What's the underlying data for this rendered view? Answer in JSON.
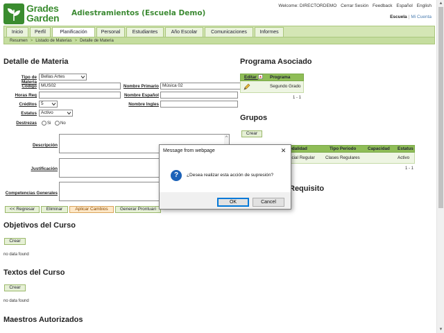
{
  "logo": {
    "line1": "Grades",
    "line2": "Garden"
  },
  "app_title": "Adiestramientos (Escuela Demo)",
  "toplinks": {
    "welcome": "Welcome: DIRECTORDEMO",
    "logout": "Cerrar Sesión",
    "feedback": "Feedback",
    "spanish": "Español",
    "english": "English"
  },
  "account": {
    "school": "Escuela",
    "my_account": "Mi Cuenta"
  },
  "nav": {
    "tabs": [
      "Inicio",
      "Perfil",
      "Planificación",
      "Personal",
      "Estudiantes",
      "Año Escolar",
      "Comunicaciones",
      "Informes"
    ],
    "active": "Planificación"
  },
  "breadcrumb": [
    "Resumen",
    "Listado de Materias",
    "Detalle de Materia"
  ],
  "detail": {
    "heading": "Detalle de Materia",
    "labels": {
      "tipo": "Tipo de Materia",
      "codigo": "Código",
      "horas": "Horas Req",
      "creditos": "Créditos",
      "estatus": "Estatus",
      "destrezas": "Destrezas",
      "nombre_primario": "Nombre Primario",
      "nombre_espanol": "Nombre Español",
      "nombre_ingles": "Nombre Ingles",
      "descripcion": "Descripción",
      "justificacion": "Justificación",
      "competencias": "Competencias Generales"
    },
    "values": {
      "tipo": "Bellas Artes",
      "codigo": "MUS02",
      "horas": "",
      "creditos": "5",
      "estatus": "Activo",
      "nombre_primario": "Música 02",
      "nombre_espanol": "",
      "nombre_ingles": ""
    },
    "radio": {
      "si": "Si",
      "no": "No"
    },
    "buttons": {
      "back": "<< Regresar",
      "delete": "Eliminar",
      "apply": "Aplicar Cambios",
      "generate": "Generar Prontuari"
    }
  },
  "objetivos": {
    "heading": "Objetivos del Curso",
    "create": "Crear",
    "nodata": "no data found"
  },
  "textos": {
    "heading": "Textos del Curso",
    "create": "Crear",
    "nodata": "no data found"
  },
  "maestros": {
    "heading": "Maestros Autorizados"
  },
  "programa": {
    "heading": "Programa Asociado",
    "columns": [
      "Editar",
      "Programa"
    ],
    "rows": [
      [
        "",
        "Segundo Grado"
      ]
    ],
    "pager": "1 - 1"
  },
  "grupos": {
    "heading": "Grupos",
    "create": "Crear",
    "columns": [
      "odalidad",
      "Tipo Periodo",
      "Capacidad",
      "Estatus"
    ],
    "rows": [
      [
        "ncial Regular",
        "Clases Regulares",
        "",
        "Activo"
      ]
    ],
    "pager": "1 - 1"
  },
  "requisito": {
    "heading": "Requisito"
  },
  "dialog": {
    "title": "Message from webpage",
    "message": "¿Desea realizar esta acción de supresión?",
    "ok": "OK",
    "cancel": "Cancel"
  },
  "colors": {
    "brand": "#3a8c2f",
    "nav_bg": "#d4e6b5",
    "table_head": "#8fbd57",
    "dialog_accent": "#0078d7"
  }
}
